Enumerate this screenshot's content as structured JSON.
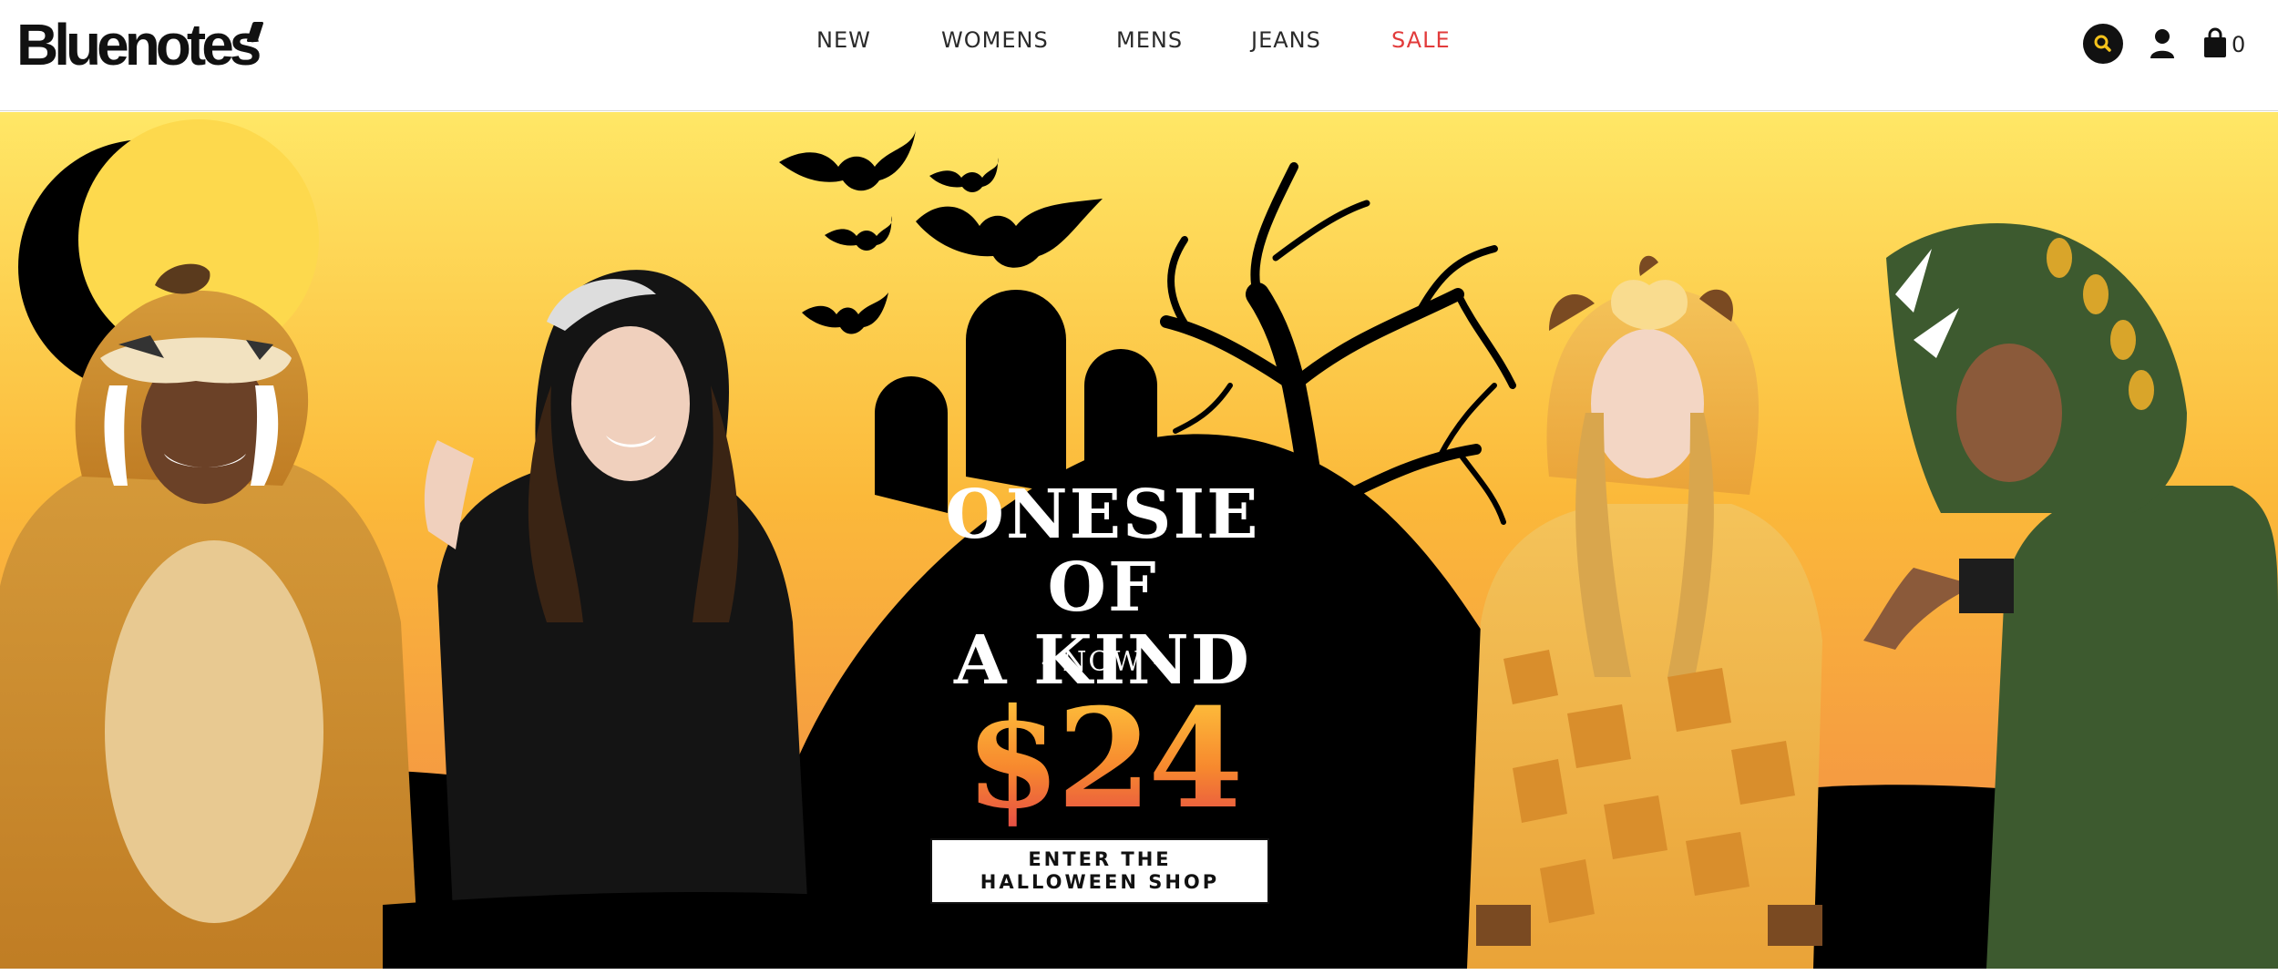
{
  "brand": {
    "logo_text": "Bluenotes"
  },
  "nav": {
    "items": [
      {
        "label": "NEW"
      },
      {
        "label": "WOMENS"
      },
      {
        "label": "MENS"
      },
      {
        "label": "JEANS"
      },
      {
        "label": "SALE",
        "color": "#e23b3b"
      }
    ]
  },
  "header_actions": {
    "search_icon": "search-icon",
    "account_icon": "user-icon",
    "cart_icon": "shopping-bag-icon",
    "cart_count": "0"
  },
  "hero": {
    "headline": "ONESIE OF\nA KIND",
    "subline": "- NOW -",
    "price": "$24",
    "cta_label": "ENTER THE\nHALLOWEEN SHOP",
    "colors": {
      "sky_top": "#ffe566",
      "sky_bottom": "#f08a44",
      "silhouette": "#000000"
    }
  }
}
